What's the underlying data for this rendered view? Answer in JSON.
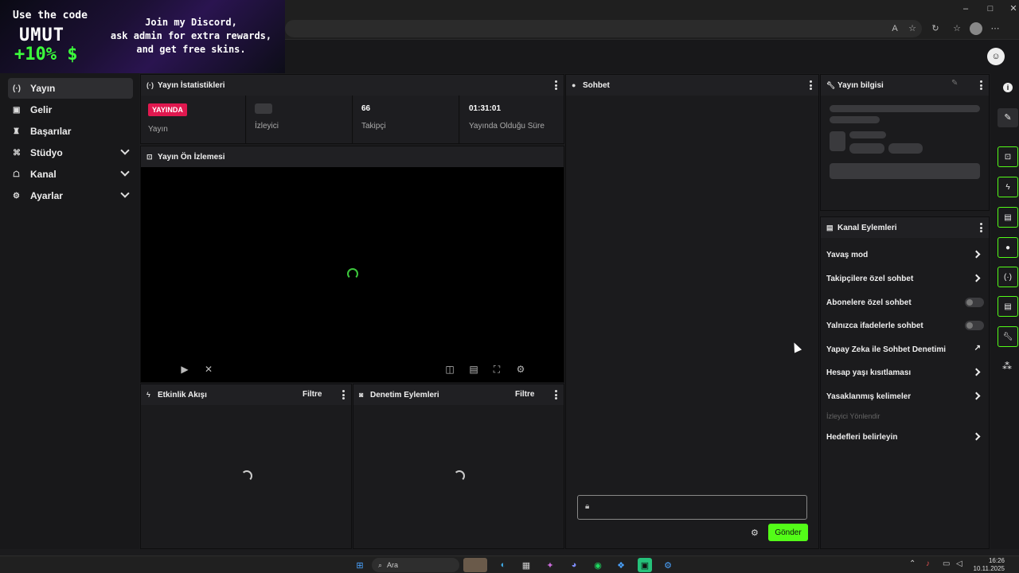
{
  "overlay": {
    "code_line": "Use the code",
    "code": "UMUT",
    "bonus": "+10% $",
    "discord_lines": [
      "Join my Discord,",
      "ask admin for extra rewards,",
      "and get free skins."
    ]
  },
  "sidebar": {
    "items": [
      {
        "label": "Yayın",
        "icon": "broadcast-icon",
        "active": true
      },
      {
        "label": "Gelir",
        "icon": "revenue-icon"
      },
      {
        "label": "Başarılar",
        "icon": "trophy-icon"
      },
      {
        "label": "Stüdyo",
        "icon": "studio-icon",
        "expandable": true
      },
      {
        "label": "Kanal",
        "icon": "channel-icon",
        "expandable": true
      },
      {
        "label": "Ayarlar",
        "icon": "gear-icon",
        "expandable": true
      }
    ]
  },
  "stats": {
    "title": "Yayın İstatistikleri",
    "badge": "YAYINDA",
    "cells": [
      {
        "value": "",
        "label": "Yayın"
      },
      {
        "value": "",
        "label": "İzleyici"
      },
      {
        "value": "66",
        "label": "Takipçi"
      },
      {
        "value": "01:31:01",
        "label": "Yayında Olduğu Süre"
      }
    ]
  },
  "preview": {
    "title": "Yayın Ön İzlemesi"
  },
  "activity": {
    "title": "Etkinlik Akışı",
    "filter": "Filtre"
  },
  "moderation": {
    "title": "Denetim Eylemleri",
    "filter": "Filtre"
  },
  "chat": {
    "title": "Sohbet",
    "send_label": "Gönder"
  },
  "stream_info": {
    "title": "Yayın bilgisi"
  },
  "channel_actions": {
    "title": "Kanal Eylemleri",
    "items": [
      {
        "label": "Yavaş mod",
        "control": "chevron"
      },
      {
        "label": "Takipçilere özel sohbet",
        "control": "chevron"
      },
      {
        "label": "Abonelere özel sohbet",
        "control": "toggle",
        "on": false
      },
      {
        "label": "Yalnızca ifadelerle sohbet",
        "control": "toggle",
        "on": false
      },
      {
        "label": "Yapay Zeka ile Sohbet Denetimi",
        "control": "external"
      },
      {
        "label": "Hesap yaşı kısıtlaması",
        "control": "chevron"
      },
      {
        "label": "Yasaklanmış kelimeler",
        "control": "chevron"
      }
    ],
    "section_label": "İzleyici Yönlendir",
    "section_items": [
      {
        "label": "Hedefleri belirleyin",
        "control": "chevron"
      }
    ]
  },
  "taskbar": {
    "search_placeholder": "Ara",
    "time": "16:26",
    "date": "10.11.2025"
  },
  "colors": {
    "accent": "#53fc18",
    "live": "#e0184f",
    "bg": "#1b1b1d"
  }
}
